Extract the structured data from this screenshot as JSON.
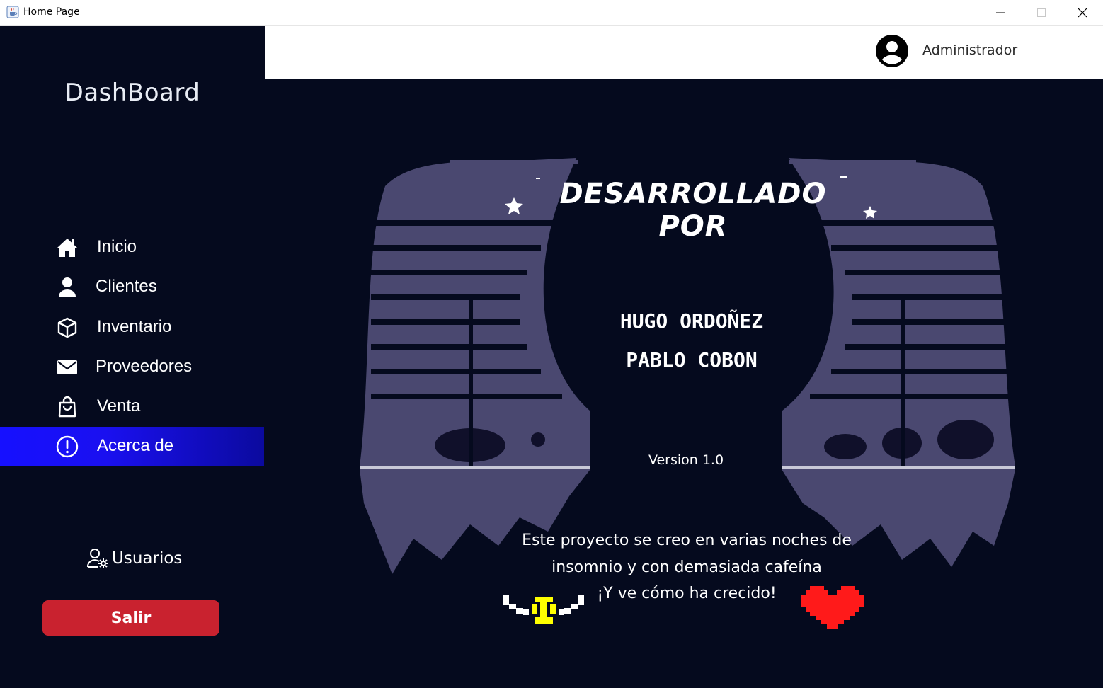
{
  "window": {
    "title": "Home Page",
    "app_icon": "java-cup-icon"
  },
  "sidebar": {
    "brand": "DashBoard",
    "items": [
      {
        "label": "Inicio",
        "icon": "home-icon",
        "active": false
      },
      {
        "label": "Clientes",
        "icon": "user-icon",
        "active": false
      },
      {
        "label": "Inventario",
        "icon": "box-icon",
        "active": false
      },
      {
        "label": "Proveedores",
        "icon": "envelope-icon",
        "active": false
      },
      {
        "label": "Venta",
        "icon": "shopping-bag-icon",
        "active": false
      },
      {
        "label": "Acerca de",
        "icon": "info-circle-icon",
        "active": true
      }
    ],
    "users_label": "Usuarios",
    "logout_label": "Salir"
  },
  "header": {
    "user_name": "Administrador"
  },
  "about": {
    "heading": "DESARROLLADO POR",
    "developers": [
      "HUGO ORDOÑEZ",
      "PABLO COBON"
    ],
    "version": "Version 1.0",
    "blurb": [
      "Este proyecto se creo en varias noches de",
      "insomnio y con demasiada cafeína",
      "¡Y ve cómo ha crecido!"
    ]
  },
  "colors": {
    "background": "#050a1e",
    "active_nav": "#1610ff",
    "logout": "#c9222f",
    "art_purple": "#4a4870",
    "heart": "#ff1a1a"
  }
}
